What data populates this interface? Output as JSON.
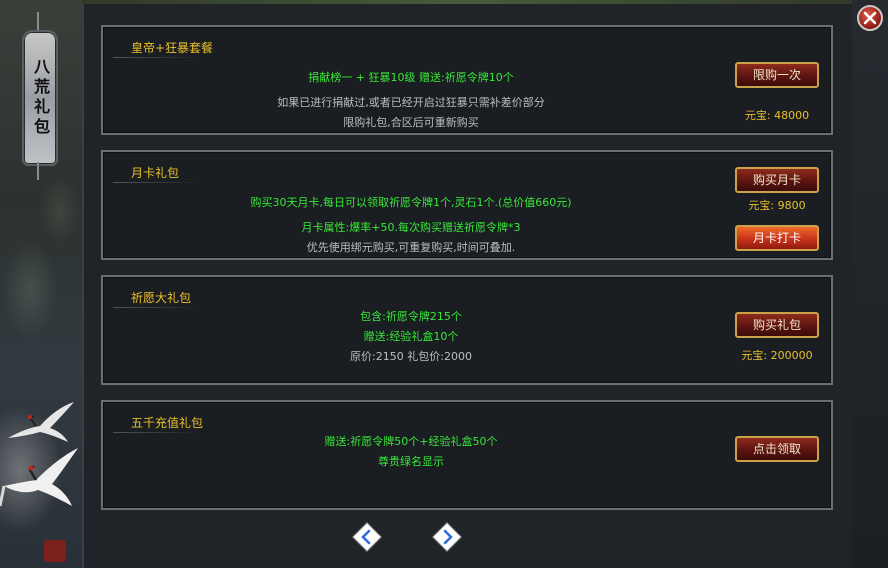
{
  "side_tab": {
    "label": "八荒礼包"
  },
  "panels": [
    {
      "title": "皇帝+狂暴套餐",
      "lines": [
        "捐献榜一    +    狂暴10级      赠送:祈愿令牌10个",
        "如果已进行捐献过,或者已经开启过狂暴只需补差价部分",
        "限购礼包,合区后可重新购买"
      ],
      "button": "限购一次",
      "price": "元宝: 48000"
    },
    {
      "title": "月卡礼包",
      "lines": [
        "购买30天月卡,每日可以领取祈愿令牌1个,灵石1个.(总价值660元)",
        "月卡属性:爆率+50.每次购买赠送祈愿令牌*3",
        "优先使用绑元购买,可重复购买,时间可叠加."
      ],
      "button": "购买月卡",
      "price": "元宝: 9800",
      "button2": "月卡打卡"
    },
    {
      "title": "祈愿大礼包",
      "lines": [
        "包含:祈愿令牌215个",
        "赠送:经验礼盒10个",
        "原价:2150  礼包价:2000"
      ],
      "button": "购买礼包",
      "price": "元宝: 200000"
    },
    {
      "title": "五千充值礼包",
      "lines": [
        "赠送:祈愿令牌50个+经验礼盒50个",
        "尊贵绿名显示"
      ],
      "button": "点击领取"
    }
  ],
  "pager": {
    "prev_icon": "chevron-left-icon",
    "next_icon": "chevron-right-icon"
  },
  "colors": {
    "title": "#e8c02a",
    "highlight_text": "#38e838",
    "normal_text": "#bdbdbd",
    "button_gold_border": "#c9a24a"
  }
}
